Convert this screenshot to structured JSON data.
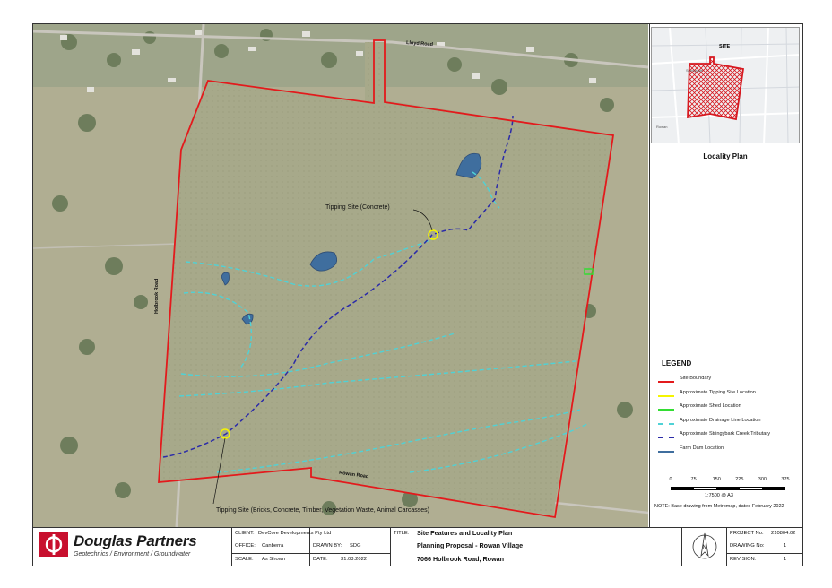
{
  "map": {
    "labels": {
      "tipping_concrete": "Tipping Site (Concrete)",
      "tipping_bricks": "Tipping Site (Bricks, Concrete, Timber, Vegetation Waste, Animal Carcasses)"
    },
    "roads": {
      "lloyd": "Lloyd Road",
      "holbrook": "Holbrook Road",
      "rowan": "Rowan Road"
    },
    "colors": {
      "site_boundary": "#e31a1c",
      "tipping_site": "#f5f500",
      "shed": "#33dd33",
      "drainage": "#4fd2d6",
      "creek": "#2b2ba8",
      "farm_dam": "#3f6e9e"
    }
  },
  "inset": {
    "site_label": "SITE",
    "title": "Locality Plan",
    "place_labels": [
      "Springvale",
      "Rowan"
    ]
  },
  "legend": {
    "title": "LEGEND",
    "items": [
      {
        "label": "Site Boundary",
        "color": "#e31a1c",
        "style": "solid"
      },
      {
        "label": "Approximate Tipping Site Location",
        "color": "#f5f500",
        "style": "solid"
      },
      {
        "label": "Approximate Shed Location",
        "color": "#33dd33",
        "style": "solid"
      },
      {
        "label": "Approximate Drainage Line Location",
        "color": "#4fd2d6",
        "style": "dashed"
      },
      {
        "label": "Approximate Stringybark Creek Tributary",
        "color": "#2b2ba8",
        "style": "dashed"
      },
      {
        "label": "Farm Dam Location",
        "color": "#3f6e9e",
        "style": "solid"
      }
    ]
  },
  "scale": {
    "ticks": [
      "0",
      "75",
      "150",
      "225",
      "300",
      "375"
    ],
    "ratio": "1:7500 @ A3"
  },
  "note": "NOTE: Base drawing from Metromap, dated February 2022",
  "title_block": {
    "company": "Douglas Partners",
    "tagline": "Geotechnics  /  Environment  /  Groundwater",
    "client_label": "CLIENT:",
    "client": "DevCore Developments Pty Ltd",
    "office_label": "OFFICE:",
    "office": "Canberra",
    "drawn_label": "DRAWN BY:",
    "drawn": "SDG",
    "scale_label": "SCALE:",
    "scale": "As Shown",
    "date_label": "DATE:",
    "date": "31.03.2022",
    "title_label": "TITLE:",
    "title_lines": [
      "Site Features and Locality Plan",
      "Planning Proposal - Rowan Village",
      "7066 Holbrook Road, Rowan"
    ],
    "north": "N",
    "project_label": "PROJECT No.",
    "project": "210804.02",
    "drawing_label": "DRAWING No:",
    "drawing": "1",
    "revision_label": "REVISION:",
    "revision": "1"
  }
}
